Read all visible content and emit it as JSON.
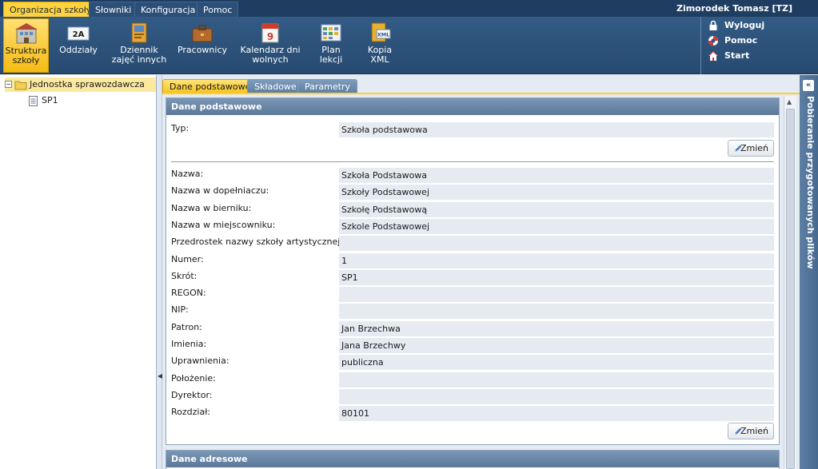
{
  "menubar": {
    "tabs": [
      {
        "label": "Organizacja szkoły",
        "active": true
      },
      {
        "label": "Słowniki",
        "active": false
      },
      {
        "label": "Konfiguracja",
        "active": false
      },
      {
        "label": "Pomoc",
        "active": false
      }
    ],
    "user": "Zimorodek Tomasz [TZ]"
  },
  "toolbar": {
    "items": [
      {
        "label": "Struktura szkoły",
        "icon": "school-structure-icon",
        "active": true
      },
      {
        "label": "Oddziały",
        "icon": "class-2a-icon",
        "active": false
      },
      {
        "label": "Dziennik zajęć innych",
        "icon": "journal-icon",
        "active": false
      },
      {
        "label": "Pracownicy",
        "icon": "briefcase-icon",
        "active": false
      },
      {
        "label": "Kalendarz dni wolnych",
        "icon": "calendar-icon",
        "active": false
      },
      {
        "label": "Plan lekcji",
        "icon": "timetable-icon",
        "active": false
      },
      {
        "label": "Kopia XML",
        "icon": "xml-file-icon",
        "active": false
      }
    ],
    "links": [
      {
        "label": "Wyloguj",
        "icon": "lock-icon"
      },
      {
        "label": "Pomoc",
        "icon": "lifebuoy-icon"
      },
      {
        "label": "Start",
        "icon": "home-icon"
      }
    ]
  },
  "tree": {
    "root": "Jednostka sprawozdawcza",
    "child": "SP1"
  },
  "content_tabs": [
    {
      "label": "Dane podstawowe",
      "active": true
    },
    {
      "label": "Składowe",
      "active": false
    },
    {
      "label": "Parametry",
      "active": false
    }
  ],
  "panel_basic": {
    "header": "Dane podstawowe",
    "type_label": "Typ:",
    "type_value": "Szkoła podstawowa",
    "change_label": "Zmień",
    "fields": [
      {
        "label": "Nazwa:",
        "value": "Szkoła Podstawowa"
      },
      {
        "label": "Nazwa w dopełniaczu:",
        "value": "Szkoły Podstawowej"
      },
      {
        "label": "Nazwa w bierniku:",
        "value": "Szkołę Podstawową"
      },
      {
        "label": "Nazwa w miejscowniku:",
        "value": "Szkole Podstawowej"
      },
      {
        "label": "Przedrostek nazwy szkoły artystycznej:",
        "value": ""
      },
      {
        "label": "Numer:",
        "value": "1"
      },
      {
        "label": "Skrót:",
        "value": "SP1"
      },
      {
        "label": "REGON:",
        "value": ""
      },
      {
        "label": "NIP:",
        "value": ""
      },
      {
        "label": "Patron:",
        "value": "Jan Brzechwa"
      },
      {
        "label": "Imienia:",
        "value": "Jana Brzechwy"
      },
      {
        "label": "Uprawnienia:",
        "value": "publiczna"
      },
      {
        "label": "Położenie:",
        "value": ""
      },
      {
        "label": "Dyrektor:",
        "value": ""
      },
      {
        "label": "Rozdział:",
        "value": "80101"
      }
    ]
  },
  "panel_address": {
    "header": "Dane adresowe"
  },
  "side_panel": {
    "title": "Pobieranie przygotowanych plików"
  },
  "colors": {
    "accent": "#ffd23f",
    "nav_dark": "#1e3d60",
    "toolbar": "#2f5681"
  }
}
